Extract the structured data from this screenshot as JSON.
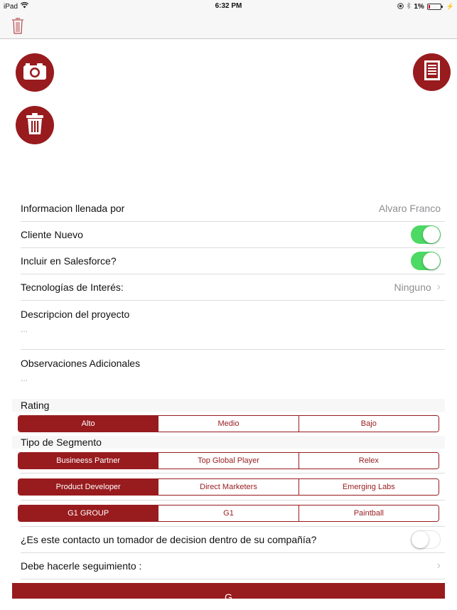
{
  "status_bar": {
    "device": "iPad",
    "time": "6:32 PM",
    "battery_percent": "1%"
  },
  "colors": {
    "brand": "#981b1e",
    "toggle_on": "#4cd964",
    "secondary_text": "#8e8e93"
  },
  "actions": {
    "camera_icon": "camera-icon",
    "delete_icon": "trash-icon",
    "document_icon": "document-icon"
  },
  "form": {
    "filled_by": {
      "label": "Informacion llenada por",
      "value": "Alvaro Franco"
    },
    "new_client": {
      "label": "Cliente Nuevo",
      "on": true
    },
    "include_salesforce": {
      "label": "Incluir en Salesforce?",
      "on": true
    },
    "technologies": {
      "label": "Tecnologías de Interés:",
      "value": "Ninguno"
    },
    "project_description": {
      "label": "Descripcion del proyecto",
      "placeholder": "..."
    },
    "additional_notes": {
      "label": "Observaciones Adicionales",
      "placeholder": "..."
    },
    "rating": {
      "header": "Rating",
      "options": [
        "Alto",
        "Medio",
        "Bajo"
      ],
      "selected": "Alto"
    },
    "segment_type": {
      "header": "Tipo de Segmento",
      "groups": [
        {
          "options": [
            "Busineess Partner",
            "Top Global Player",
            "Relex"
          ],
          "selected": "Busineess Partner"
        },
        {
          "options": [
            "Product Developer",
            "Direct Marketers",
            "Emerging Labs"
          ],
          "selected": "Product Developer"
        },
        {
          "options": [
            "G1 GROUP",
            "G1",
            "Paintball"
          ],
          "selected": "G1 GROUP"
        }
      ]
    },
    "decision_maker": {
      "label": "¿Es este contacto un tomador de decision dentro de su compañía?",
      "on": false
    },
    "follow_up": {
      "label": "Debe hacerle seguimiento :"
    },
    "save_button": {
      "label": "G"
    }
  }
}
